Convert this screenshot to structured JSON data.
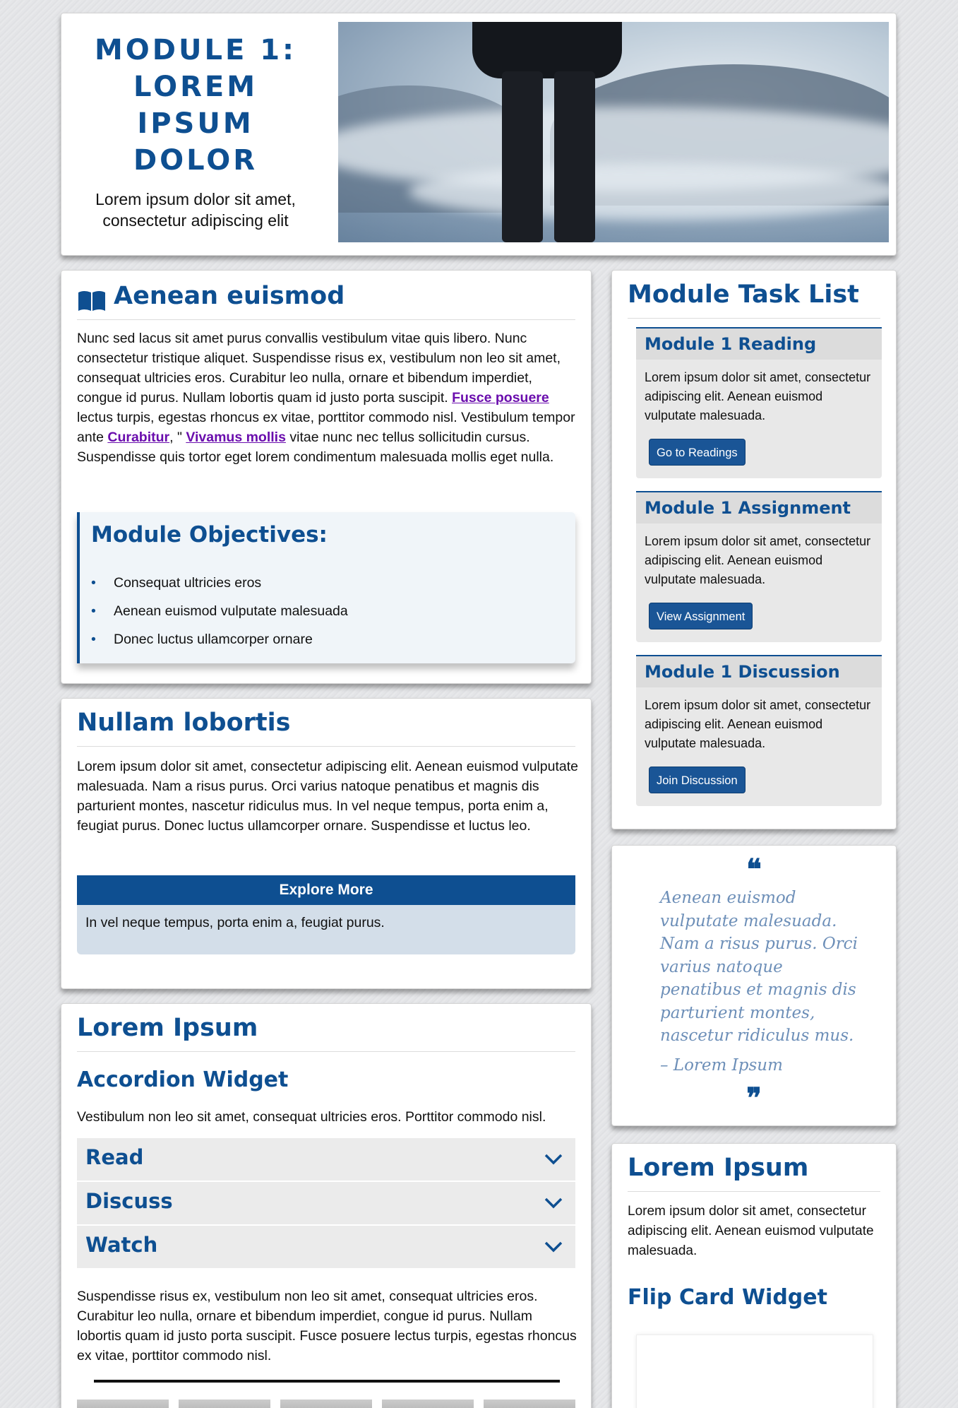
{
  "banner": {
    "title": "MODULE 1: LOREM IPSUM DOLOR",
    "subtitle": "Lorem ipsum dolor sit amet, consectetur adipiscing elit"
  },
  "aenean": {
    "heading": "Aenean euismod",
    "p_part1": "Nunc sed lacus sit amet purus convallis vestibulum vitae quis libero. Nunc consectetur tristique aliquet. Suspendisse risus ex, vestibulum non leo sit amet, consequat ultricies eros. Curabitur leo nulla, ornare et bibendum imperdiet, congue id purus. Nullam lobortis quam id justo porta suscipit. ",
    "link1": "Fusce posuere",
    "p_part2": " lectus turpis, egestas rhoncus ex vitae, porttitor commodo nisl. Vestibulum tempor ante ",
    "link2": "Curabitur",
    "p_part3": ", \" ",
    "link3": "Vivamus mollis",
    "p_part4": " vitae nunc nec tellus sollicitudin cursus. Suspendisse quis tortor eget lorem condimentum malesuada mollis eget nulla.",
    "objectives_heading": "Module Objectives:",
    "objectives": [
      "Consequat ultricies eros",
      "Aenean euismod vulputate malesuada",
      "Donec luctus ullamcorper ornare"
    ]
  },
  "nullam": {
    "heading": "Nullam lobortis",
    "paragraph": "Lorem ipsum dolor sit amet, consectetur adipiscing elit. Aenean euismod vulputate malesuada. Nam a risus purus. Orci varius natoque penatibus et magnis dis parturient montes, nascetur ridiculus mus. In vel neque tempus, porta enim a, feugiat purus. Donec luctus ullamcorper ornare. Suspendisse et luctus leo.",
    "explore_title": "Explore More",
    "explore_body": "In vel neque tempus, porta enim a, feugiat purus."
  },
  "lorem": {
    "heading": "Lorem Ipsum",
    "accordion_heading": "Accordion Widget",
    "accordion_intro": "Vestibulum non leo sit amet, consequat ultricies eros. Porttitor commodo nisl.",
    "accordion_items": [
      "Read",
      "Discuss",
      "Watch"
    ],
    "after_text": "Suspendisse risus ex, vestibulum non leo sit amet, consequat ultricies eros. Curabitur leo nulla, ornare et bibendum imperdiet, congue id purus. Nullam lobortis quam id justo porta suscipit. Fusce posuere lectus turpis, egestas rhoncus ex vitae, porttitor commodo nisl."
  },
  "tasks": {
    "heading": "Module Task List",
    "items": [
      {
        "title": "Module 1 Reading",
        "body": "Lorem ipsum dolor sit amet, consectetur adipiscing elit. Aenean euismod vulputate malesuada.",
        "button": "Go to Readings"
      },
      {
        "title": "Module 1 Assignment",
        "body": "Lorem ipsum dolor sit amet, consectetur adipiscing elit. Aenean euismod vulputate malesuada.",
        "button": "View Assignment"
      },
      {
        "title": "Module 1 Discussion",
        "body": "Lorem ipsum dolor sit amet, consectetur adipiscing elit. Aenean euismod vulputate malesuada.",
        "button": "Join Discussion"
      }
    ]
  },
  "quote": {
    "open": "❝",
    "text": "Aenean euismod vulputate malesuada. Nam a risus purus. Orci varius natoque penatibus et magnis dis parturient montes, nascetur ridiculus mus.",
    "author": "– Lorem Ipsum",
    "close": "❞"
  },
  "lorem2": {
    "heading": "Lorem Ipsum",
    "body": "Lorem ipsum dolor sit amet, consectetur adipiscing elit. Aenean euismod vulputate malesuada.",
    "flip_heading": "Flip Card Widget"
  },
  "icons": {
    "book": "book-icon",
    "chevron": "chevron-down-icon"
  },
  "colors": {
    "brand_blue": "#0e4f91",
    "link_purple": "#6a0dad",
    "quote_blue": "#6d8fb8"
  }
}
